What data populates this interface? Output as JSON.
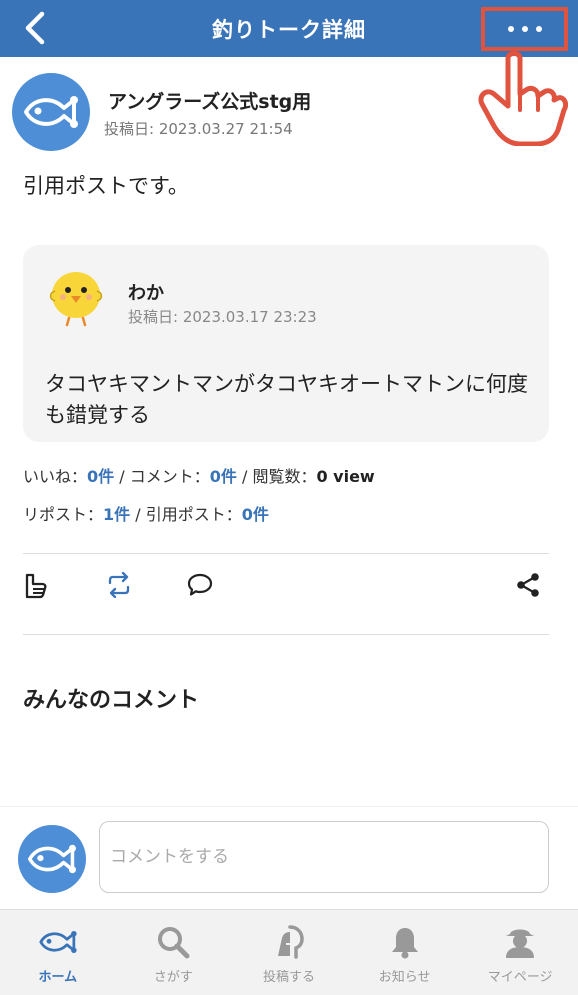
{
  "header": {
    "title": "釣りトーク詳細"
  },
  "post": {
    "author": "アングラーズ公式stg用",
    "date": "投稿日: 2023.03.27 21:54",
    "body": "引用ポストです。"
  },
  "quote": {
    "author": "わか",
    "date": "投稿日: 2023.03.17 23:23",
    "body": "タコヤキマントマンがタコヤキオートマトンに何度も錯覚する"
  },
  "stats": {
    "likes_label": "いいね：",
    "likes_value": "0件",
    "comments_label": " / コメント：",
    "comments_value": "0件",
    "views_label": " / 閲覧数：",
    "views_value": "0 view",
    "reposts_label": "リポスト：",
    "reposts_value": "1件",
    "quotes_label": " / 引用ポスト：",
    "quotes_value": "0件"
  },
  "comments_section": {
    "title": "みんなのコメント"
  },
  "comment_input": {
    "placeholder": "コメントをする"
  },
  "tabs": [
    {
      "label": "ホーム",
      "icon": "fish-icon",
      "active": true
    },
    {
      "label": "さがす",
      "icon": "search-icon",
      "active": false
    },
    {
      "label": "投稿する",
      "icon": "post-icon",
      "active": false
    },
    {
      "label": "お知らせ",
      "icon": "bell-icon",
      "active": false
    },
    {
      "label": "マイページ",
      "icon": "user-icon",
      "active": false
    }
  ],
  "colors": {
    "brand": "#3a74b8",
    "highlight": "#e0533f",
    "avatar": "#4d8ed6"
  }
}
